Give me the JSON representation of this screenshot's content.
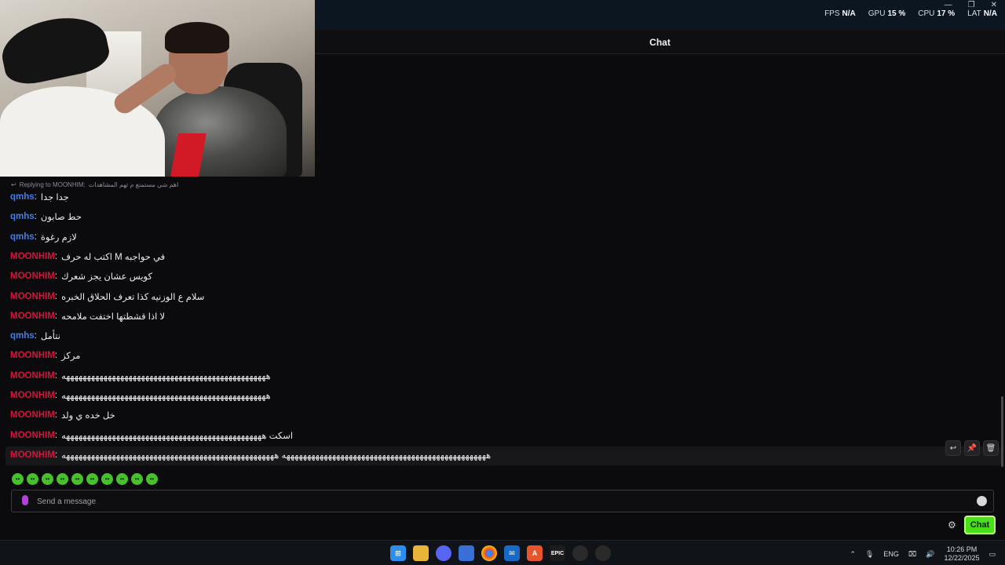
{
  "overlay": {
    "stats": [
      {
        "label": "FPS",
        "value": "N/A"
      },
      {
        "label": "GPU",
        "value": "15 %"
      },
      {
        "label": "CPU",
        "value": "17 %"
      },
      {
        "label": "LAT",
        "value": "N/A"
      }
    ],
    "window_controls": [
      "—",
      "❐",
      "✕"
    ]
  },
  "chat": {
    "title": "Chat",
    "reply": {
      "icon": "reply-icon",
      "label": "Replying to MOONHIM:",
      "text": "اهم شي مستمتع م تهم المشاهدات"
    },
    "messages": [
      {
        "user": "qmhs",
        "color": "blue",
        "text": "جدا جدا"
      },
      {
        "user": "qmhs",
        "color": "blue",
        "text": "حط صابون"
      },
      {
        "user": "qmhs",
        "color": "blue",
        "text": "لازم رغوة"
      },
      {
        "user": "MOONHIM",
        "color": "red",
        "text": "في حواجبه M اكتب له حرف"
      },
      {
        "user": "MOONHIM",
        "color": "red",
        "text": "كويس عشان يجز شعرك"
      },
      {
        "user": "MOONHIM",
        "color": "red",
        "text": "سلام ع الوزنيه كذا تعرف الحلاق الخبره"
      },
      {
        "user": "MOONHIM",
        "color": "red",
        "text": "لا اذا قشطتها اختفت ملامحه"
      },
      {
        "user": "qmhs",
        "color": "blue",
        "text": "نتأمل"
      },
      {
        "user": "MOONHIM",
        "color": "red",
        "text": "مركز"
      },
      {
        "user": "MOONHIM",
        "color": "red",
        "text": "هههههههههههههههههههههههههههههههههههههههههههههههههه"
      },
      {
        "user": "MOONHIM",
        "color": "red",
        "text": "هههههههههههههههههههههههههههههههههههههههههههههههههه"
      },
      {
        "user": "MOONHIM",
        "color": "red",
        "text": "خل خده ي ولد"
      },
      {
        "user": "MOONHIM",
        "color": "red",
        "text": "اسكت ههههههههههههههههههههههههههههههههههههههههههههههههه"
      },
      {
        "user": "MOONHIM",
        "color": "red",
        "text": "هههههههههههههههههههههههههههههههههههههههههههههههههه هههههههههههههههههههههههههههههههههههههههههههههههههههه"
      }
    ],
    "row_actions": [
      "reply-icon",
      "pin-icon",
      "trash-icon"
    ],
    "emotes": [
      "frog-emote",
      "frog-emote",
      "frog-emote",
      "frog-emote",
      "frog-emote",
      "frog-emote",
      "frog-emote",
      "frog-emote",
      "frog-emote",
      "frog-emote"
    ],
    "input": {
      "placeholder": "Send a message"
    },
    "send_label": "Chat"
  },
  "colors": {
    "blue": "#3f7ee8",
    "red": "#d2143a",
    "accent": "#47e01a"
  },
  "taskbar": {
    "apps": [
      "windows-start",
      "file-explorer",
      "discord",
      "microsoft-store",
      "chrome",
      "mail",
      "app-a",
      "epic-games",
      "obs",
      "steam"
    ],
    "tray": {
      "lang": "ENG",
      "time": "10:26 PM",
      "date": "12/22/2025"
    }
  }
}
